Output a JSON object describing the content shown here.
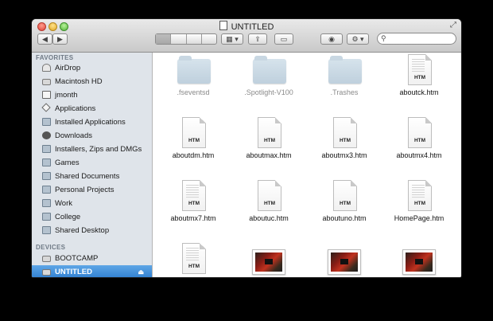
{
  "window": {
    "title": "UNTITLED"
  },
  "toolbar": {
    "back_label": "◀",
    "forward_label": "▶",
    "arrange_label": "▦ ▾",
    "share_label": "⇪",
    "tags_label": "▭",
    "quicklook_label": "◉",
    "action_label": "⚙ ▾",
    "search_placeholder": ""
  },
  "sidebar": {
    "favorites_heading": "FAVORITES",
    "favorites": [
      {
        "label": "AirDrop",
        "icon": "airdrop-icon"
      },
      {
        "label": "Macintosh HD",
        "icon": "hard-drive-icon"
      },
      {
        "label": "jmonth",
        "icon": "home-icon"
      },
      {
        "label": "Applications",
        "icon": "applications-icon"
      },
      {
        "label": "Installed Applications",
        "icon": "folder-icon"
      },
      {
        "label": "Downloads",
        "icon": "downloads-icon"
      },
      {
        "label": "Installers, Zips and DMGs",
        "icon": "folder-icon"
      },
      {
        "label": "Games",
        "icon": "folder-icon"
      },
      {
        "label": "Shared Documents",
        "icon": "folder-icon"
      },
      {
        "label": "Personal Projects",
        "icon": "folder-icon"
      },
      {
        "label": "Work",
        "icon": "folder-icon"
      },
      {
        "label": "College",
        "icon": "folder-icon"
      },
      {
        "label": "Shared Desktop",
        "icon": "folder-icon"
      }
    ],
    "devices_heading": "DEVICES",
    "devices": [
      {
        "label": "BOOTCAMP",
        "icon": "disk-icon",
        "selected": false
      },
      {
        "label": "UNTITLED",
        "icon": "disk-icon",
        "selected": true,
        "eject": "⏏"
      }
    ]
  },
  "files": [
    {
      "name": ".fseventsd",
      "kind": "folder",
      "hidden": true
    },
    {
      "name": ".Spotlight-V100",
      "kind": "folder",
      "hidden": true
    },
    {
      "name": ".Trashes",
      "kind": "folder",
      "hidden": true
    },
    {
      "name": "aboutck.htm",
      "kind": "htm-preview",
      "ext": "HTM"
    },
    {
      "name": "aboutdm.htm",
      "kind": "htm",
      "ext": "HTM"
    },
    {
      "name": "aboutmax.htm",
      "kind": "htm",
      "ext": "HTM"
    },
    {
      "name": "aboutmx3.htm",
      "kind": "htm",
      "ext": "HTM"
    },
    {
      "name": "aboutmx4.htm",
      "kind": "htm",
      "ext": "HTM"
    },
    {
      "name": "aboutmx7.htm",
      "kind": "htm-preview",
      "ext": "HTM"
    },
    {
      "name": "aboutuc.htm",
      "kind": "htm",
      "ext": "HTM"
    },
    {
      "name": "aboutuno.htm",
      "kind": "htm",
      "ext": "HTM"
    },
    {
      "name": "HomePage.htm",
      "kind": "htm-preview",
      "ext": "HTM"
    },
    {
      "name": "",
      "kind": "htm-preview",
      "ext": "HTM"
    },
    {
      "name": "",
      "kind": "image"
    },
    {
      "name": "",
      "kind": "image"
    },
    {
      "name": "",
      "kind": "image"
    }
  ]
}
